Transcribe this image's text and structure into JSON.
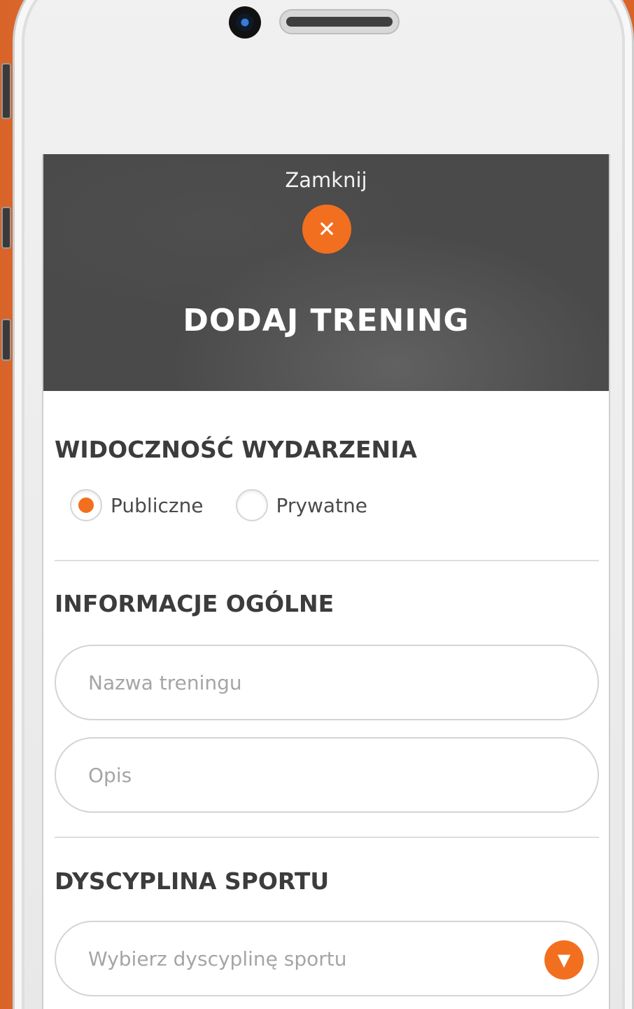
{
  "header": {
    "close_label": "Zamknij",
    "close_icon": "✕",
    "title": "DODAJ TRENING"
  },
  "visibility": {
    "title": "WIDOCZNOŚĆ WYDARZENIA",
    "options": [
      {
        "label": "Publiczne",
        "selected": true
      },
      {
        "label": "Prywatne",
        "selected": false
      }
    ]
  },
  "general": {
    "title": "INFORMACJE OGÓLNE",
    "name_placeholder": "Nazwa treningu",
    "description_placeholder": "Opis"
  },
  "sport": {
    "title": "DYSCYPLINA SPORTU",
    "select_placeholder": "Wybierz dyscyplinę sportu",
    "arrow_icon": "▼"
  },
  "colors": {
    "accent": "#f26f1f",
    "hero_bg": "#4a4a4a"
  }
}
